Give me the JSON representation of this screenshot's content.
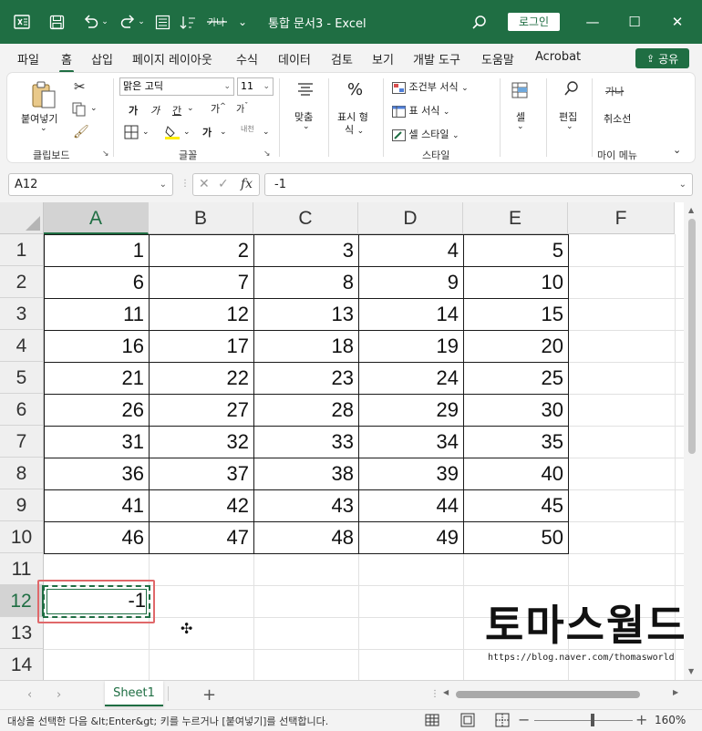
{
  "title": "통합 문서3  -  Excel",
  "login_label": "로그인",
  "menu": [
    "파일",
    "홈",
    "삽입",
    "페이지 레이아웃",
    "수식",
    "데이터",
    "검토",
    "보기",
    "개발 도구",
    "도움말",
    "Acrobat"
  ],
  "share_label": "공유",
  "ribbon": {
    "paste_label": "붙여넣기",
    "clipboard_label": "클립보드",
    "font_name": "맑은 고딕",
    "font_size": "11",
    "font_label": "글꼴",
    "bold": "가",
    "italic": "가",
    "underline": "간",
    "grow": "가",
    "shrink": "가",
    "fill": "가",
    "phonetic": "내천",
    "align_label": "맞춤",
    "number_label": "표시 형식",
    "number_line1": "표시 형",
    "number_line2": "식",
    "percent": "%",
    "cond_format": "조건부 서식",
    "table_format": "표 서식",
    "cell_style": "셀 스타일",
    "style_label": "스타일",
    "cells_label": "셀",
    "edit_label": "편집",
    "strike_sample": "가나",
    "cancel_line": "취소선",
    "my_menu": "마이 메뉴"
  },
  "formula_bar": {
    "name_box": "A12",
    "fx": "fx",
    "value": "-1"
  },
  "columns": [
    "A",
    "B",
    "C",
    "D",
    "E",
    "F"
  ],
  "rows": [
    "1",
    "2",
    "3",
    "4",
    "5",
    "6",
    "7",
    "8",
    "9",
    "10",
    "11",
    "12",
    "13",
    "14"
  ],
  "table": [
    [
      "1",
      "2",
      "3",
      "4",
      "5"
    ],
    [
      "6",
      "7",
      "8",
      "9",
      "10"
    ],
    [
      "11",
      "12",
      "13",
      "14",
      "15"
    ],
    [
      "16",
      "17",
      "18",
      "19",
      "20"
    ],
    [
      "21",
      "22",
      "23",
      "24",
      "25"
    ],
    [
      "26",
      "27",
      "28",
      "29",
      "30"
    ],
    [
      "31",
      "32",
      "33",
      "34",
      "35"
    ],
    [
      "36",
      "37",
      "38",
      "39",
      "40"
    ],
    [
      "41",
      "42",
      "43",
      "44",
      "45"
    ],
    [
      "46",
      "47",
      "48",
      "49",
      "50"
    ]
  ],
  "selected_cell_value": "-1",
  "watermark": "토마스월드",
  "watermark_url": "https://blog.naver.com/thomasworld",
  "sheet_tab": "Sheet1",
  "add_sheet": "+",
  "status": "대상을 선택한 다음 &lt;Enter&gt; 키를 누르거나 [붙여넣기]를 선택합니다.",
  "zoom": "160%",
  "colors": {
    "brand": "#1f6e43",
    "highlight": "#e0686a"
  }
}
